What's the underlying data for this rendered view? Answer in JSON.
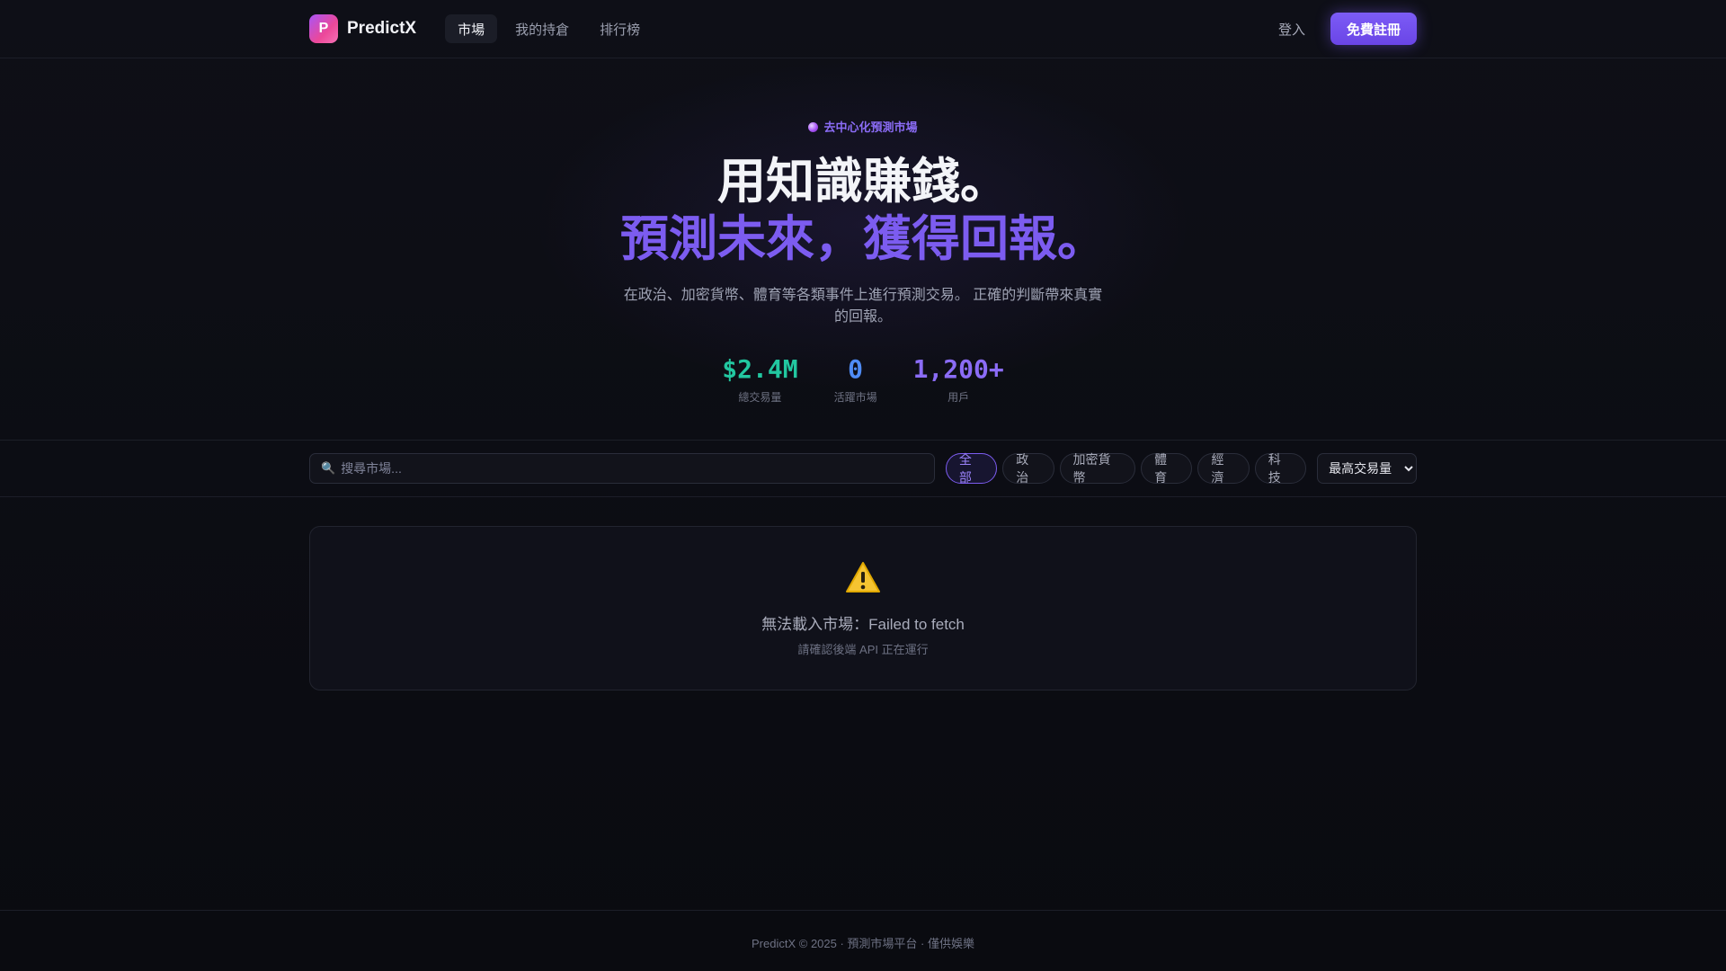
{
  "header": {
    "logo_letter": "P",
    "brand": "PredictX",
    "nav": [
      {
        "label": "市場",
        "active": true
      },
      {
        "label": "我的持倉",
        "active": false
      },
      {
        "label": "排行榜",
        "active": false
      }
    ],
    "login_label": "登入",
    "signup_label": "免費註冊"
  },
  "hero": {
    "badge": "去中心化預測市場",
    "title_line1": "用知識賺錢。",
    "title_line2": "預測未來，獲得回報。",
    "subtitle": "在政治、加密貨幣、體育等各類事件上進行預測交易。 正確的判斷帶來真實的回報。",
    "stats": [
      {
        "value": "$2.4M",
        "label": "總交易量",
        "color": "#22c7a0"
      },
      {
        "value": "0",
        "label": "活躍市場",
        "color": "#4f8cf6"
      },
      {
        "value": "1,200+",
        "label": "用戶",
        "color": "#8b6cf6"
      }
    ]
  },
  "filters": {
    "search_placeholder": "搜尋市場...",
    "categories": [
      {
        "label": "全部",
        "active": true
      },
      {
        "label": "政治",
        "active": false
      },
      {
        "label": "加密貨幣",
        "active": false
      },
      {
        "label": "體育",
        "active": false
      },
      {
        "label": "經濟",
        "active": false
      },
      {
        "label": "科技",
        "active": false
      }
    ],
    "sort_selected": "最高交易量"
  },
  "error": {
    "icon": "warning-icon",
    "message": "無法載入市場：Failed to fetch",
    "hint": "請確認後端 API 正在運行"
  },
  "footer": {
    "text": "PredictX © 2025 · 預測市場平台 · 僅供娛樂"
  },
  "colors": {
    "accent": "#7c5cf0",
    "background": "#0b0c12"
  }
}
